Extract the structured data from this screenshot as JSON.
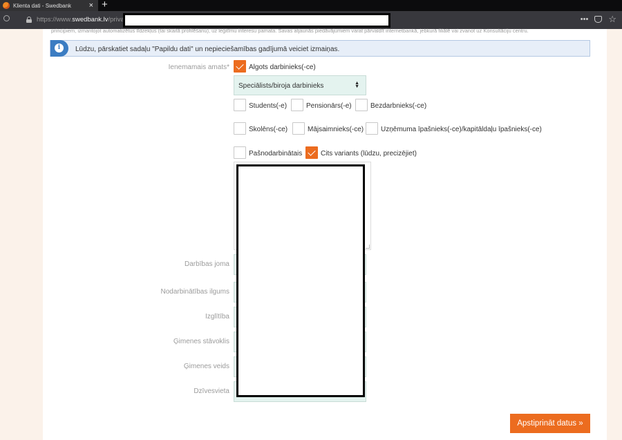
{
  "browser": {
    "tab_title": "Klienta dati - Swedbank",
    "tab_close": "×",
    "new_tab": "+",
    "url_prefix": "https://www.",
    "url_host": "swedbank.lv",
    "url_path": "/privat",
    "menu_dots": "•••"
  },
  "page": {
    "top_text": "principiem, izmantojot automatizētus līdzekļus (tai skaitā profilēšanu), uz leģitīmu interesu pamata. Savas atjaunās piedāvājumiem varat pārvaldīt internetbankā, jebkurā filiālē vai zvanot uz Konsultāciju centru.",
    "info": {
      "icon": "i",
      "text": "Lūdzu, pārskatiet sadaļu \"Papildu dati\" un nepieciešamības gadījumā veiciet izmaiņas."
    },
    "income_label": "Ienemamais amats*",
    "checkboxes": [
      {
        "label": "Algots darbinieks(-ce)",
        "checked": true
      },
      {
        "label": "Students(-e)",
        "checked": false
      },
      {
        "label": "Pensionārs(-e)",
        "checked": false
      },
      {
        "label": "Bezdarbnieks(-ce)",
        "checked": false
      },
      {
        "label": "Skolēns(-ce)",
        "checked": false
      },
      {
        "label": "Mājsaimnieks(-ce)",
        "checked": false
      },
      {
        "label": "Uzņēmuma īpašnieks(-ce)/kapitāldaļu īpašnieks(-ce)",
        "checked": false
      },
      {
        "label": "Pašnodarbinātais",
        "checked": false
      },
      {
        "label": "Cits variants (lūdzu, precizējiet)",
        "checked": true
      }
    ],
    "position_select": "Speciālists/biroja darbinieks",
    "select_arrows": "▲▼",
    "fields": {
      "work_area": "Darbības joma",
      "employment_length": "Nodarbinātības ilgums",
      "education": "Izglītība",
      "marital_status": "Ģimenes stāvoklis",
      "family_type": "Ģimenes veids",
      "residence": "Dzīvesvieta"
    },
    "confirm_button": "Apstiprināt datus »"
  },
  "colors": {
    "accent": "#ec6c1f",
    "info_blue": "#3b7cc2",
    "field_bg": "#e4f3ef",
    "page_bg": "#fbf2ea"
  }
}
